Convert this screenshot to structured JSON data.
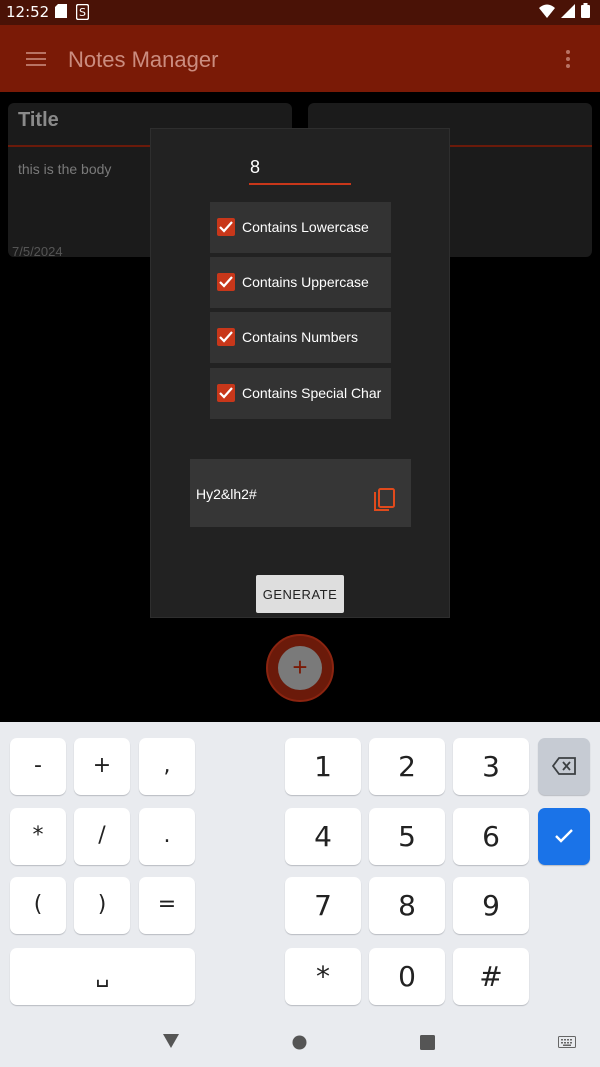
{
  "status_bar": {
    "time": "12:52",
    "icons": [
      "sd-card-icon",
      "s-icon",
      "wifi-icon",
      "signal-icon",
      "battery-icon"
    ]
  },
  "app_bar": {
    "title": "Notes Manager",
    "icons": [
      "hamburger-menu-icon",
      "more-vert-icon"
    ]
  },
  "notes": [
    {
      "title": "Title",
      "body": "this is the body",
      "date": "7/5/2024"
    },
    {
      "title": "",
      "body": "",
      "date": ""
    }
  ],
  "dialog": {
    "length_value": "8",
    "options": [
      {
        "label": "Contains Lowercase",
        "checked": true
      },
      {
        "label": "Contains Uppercase",
        "checked": true
      },
      {
        "label": "Contains Numbers",
        "checked": true
      },
      {
        "label": "Contains Special Char",
        "checked": true
      }
    ],
    "password": "Hy2&lh2#",
    "generate_label": "GENERATE"
  },
  "keyboard": {
    "symbol_keys": [
      "-",
      "+",
      ",",
      "*",
      "/",
      ".",
      "(",
      ")",
      "="
    ],
    "number_keys": [
      "1",
      "2",
      "3",
      "4",
      "5",
      "6",
      "7",
      "8",
      "9",
      "*",
      "0",
      "#"
    ],
    "space_label": "␣"
  },
  "colors": {
    "app_bar": "#7a1a06",
    "status_bar": "#4a1206",
    "accent": "#c8371a",
    "keyboard_bg": "#e9ebef",
    "confirm_key": "#1a73e8"
  }
}
